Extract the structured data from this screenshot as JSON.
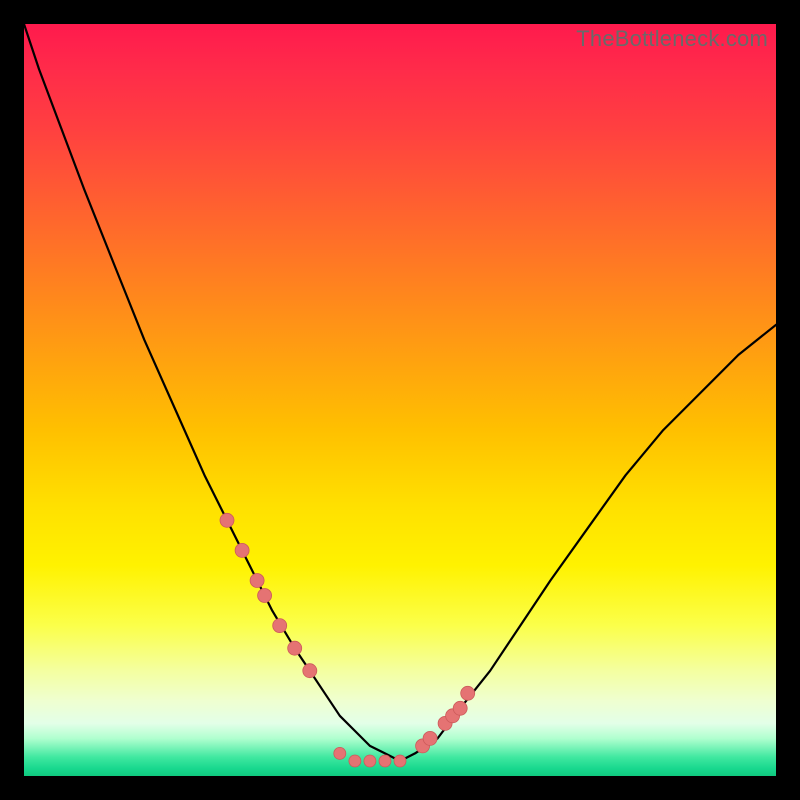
{
  "watermark": "TheBottleneck.com",
  "colors": {
    "curve": "#000000",
    "marker_fill": "#e57373",
    "marker_stroke": "#cc5a5a",
    "gradient_top": "#ff1a4d",
    "gradient_bottom": "#10c97f",
    "frame": "#000000"
  },
  "chart_data": {
    "type": "line",
    "title": "",
    "xlabel": "",
    "ylabel": "",
    "xlim": [
      0,
      100
    ],
    "ylim": [
      0,
      100
    ],
    "curve": {
      "x": [
        0,
        2,
        5,
        8,
        12,
        16,
        20,
        24,
        27,
        30,
        33,
        36,
        38,
        40,
        42,
        44,
        46,
        48,
        50,
        52,
        55,
        58,
        62,
        66,
        70,
        75,
        80,
        85,
        90,
        95,
        100
      ],
      "y": [
        100,
        94,
        86,
        78,
        68,
        58,
        49,
        40,
        34,
        28,
        22,
        17,
        14,
        11,
        8,
        6,
        4,
        3,
        2,
        3,
        5,
        9,
        14,
        20,
        26,
        33,
        40,
        46,
        51,
        56,
        60
      ]
    },
    "markers_left": {
      "x": [
        27,
        29,
        31,
        32,
        34,
        36,
        38
      ],
      "y": [
        34,
        30,
        26,
        24,
        20,
        17,
        14
      ]
    },
    "markers_right": {
      "x": [
        53,
        54,
        56,
        57,
        58,
        59
      ],
      "y": [
        4,
        5,
        7,
        8,
        9,
        11
      ]
    },
    "markers_bottom": {
      "x": [
        42,
        44,
        46,
        48,
        50
      ],
      "y": [
        3,
        2,
        2,
        2,
        2
      ]
    }
  }
}
